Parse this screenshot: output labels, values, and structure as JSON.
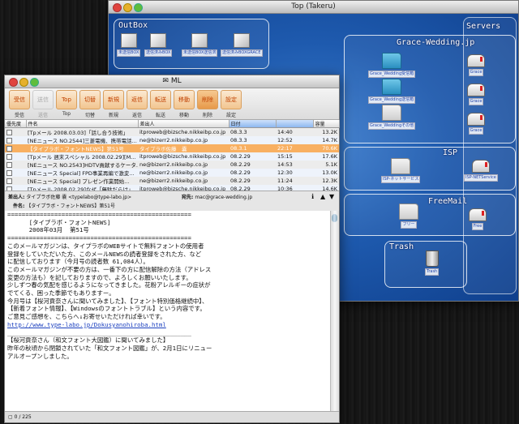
{
  "top_window": {
    "title": "Top (Takeru)",
    "outbox": {
      "label": "OutBox",
      "items": [
        "未送信BOX",
        "送信済みBOX",
        "未送信BOX送信済",
        "送信済みBOXGRACE"
      ]
    },
    "servers": {
      "label": "Servers"
    },
    "grace": {
      "label": "Grace-Wedding.jp",
      "folders": [
        "Grace_Wedding受信箱",
        "Grace_Wedding送信箱",
        "Grace_Weddingその他"
      ],
      "servers": [
        "Grace",
        "Grace",
        "Grace"
      ]
    },
    "isp": {
      "label": "ISP",
      "folder": "ISP-ネットサービス",
      "server": "ISP-NETService"
    },
    "freemail": {
      "label": "FreeMail",
      "folder": "フリー",
      "server": "Free"
    },
    "trash": {
      "label": "Trash",
      "icon_label": "Trash"
    }
  },
  "ml_window": {
    "title": "ML",
    "toolbar": [
      {
        "icon": "受信",
        "label": "受信",
        "disabled": false
      },
      {
        "icon": "送信",
        "label": "送信",
        "disabled": true
      },
      {
        "icon": "Top",
        "label": "Top",
        "disabled": false
      },
      {
        "icon": "切替",
        "label": "切替",
        "disabled": false
      },
      {
        "icon": "新規",
        "label": "新規",
        "disabled": false
      },
      {
        "icon": "返信",
        "label": "返信",
        "disabled": false
      },
      {
        "icon": "転送",
        "label": "転送",
        "disabled": false
      },
      {
        "icon": "移動",
        "label": "移動",
        "disabled": false
      },
      {
        "icon": "削除",
        "label": "削除",
        "disabled": false
      },
      {
        "icon": "設定",
        "label": "設定",
        "disabled": false
      }
    ],
    "columns": [
      "優先度",
      "件名",
      "差出人",
      "日付",
      "",
      "容量"
    ],
    "rows": [
      {
        "subject": "[Tpメール 2008.03.03]「話し合う技術」",
        "from": "itproweb@bizsche.nikkeibp.co.jp",
        "date": "08.3.3",
        "time": "14:40",
        "size": "13.2K"
      },
      {
        "subject": "[NEニュース NO.2544]三菱電機、携帯電話...",
        "from": "ne@bizerr2.nikkeibp.co.jp",
        "date": "08.3.3",
        "time": "12:52",
        "size": "14.7K"
      },
      {
        "subject": "【タイプラボ・フォントNEWS】第51号",
        "from": "タイプラボ佐藤　嚢",
        "date": "08.3.1",
        "time": "22:17",
        "size": "70.6K"
      },
      {
        "subject": "[Tpメール 週末スペシャル 2008.02.29][M...",
        "from": "itproweb@bizsche.nikkeibp.co.jp",
        "date": "08.2.29",
        "time": "15:15",
        "size": "17.6K"
      },
      {
        "subject": "[NEニュース NO.2543]HDTV貢献するケータ...",
        "from": "ne@bizerr2.nikkeibp.co.jp",
        "date": "08.2.29",
        "time": "14:53",
        "size": "5.1K"
      },
      {
        "subject": "[NEニュース Special] FPD事業再編で激変...",
        "from": "ne@bizerr2.nikkeibp.co.jp",
        "date": "08.2.29",
        "time": "12:30",
        "size": "13.0K"
      },
      {
        "subject": "[NEニュース Special] プレゼン作業開始...",
        "from": "ne@bizerr2.nikkeibp.co.jp",
        "date": "08.2.29",
        "time": "11:24",
        "size": "12.3K"
      },
      {
        "subject": "[Tpメール 2008.02.29]なぜ「無駄だらけ」...",
        "from": "itproweb@bizsche.nikkeibp.co.jp",
        "date": "08.2.29",
        "time": "10:36",
        "size": "14.6K"
      }
    ],
    "header": {
      "from_label": "差出人:",
      "from_value": "タイプラボ佐藤 嚢 <typelabo@type-labo.jp>",
      "subject_label": "件名:",
      "subject_value": "【タイプラボ・フォントNEWS】第51号",
      "to_label": "宛先:",
      "to_value": "mac@grace-wedding.jp"
    },
    "body_lines": [
      "",
      "===================================================",
      "      [タイプラボ・フォントNEWS]",
      "      2008年03月  第51号",
      "===================================================",
      "",
      "このメールマガジンは、タイプラボのWEBサイトで無料フォントの使用者",
      "登録をしていただいた方、このメールNEWSの読者登録をされた方、など",
      "に配信しております（今月号の読者数 61,084人）。",
      "",
      "このメールマガジンが不要の方は、一番下の方に配信解除の方法（アドレス",
      "変更の方法も）を記しておりますので、よろしくお願いいたします。",
      "",
      "少しずつ春の気配を感じるようになってきました。花粉アレルギーの症状が",
      "でてくる、困った季節でもありますー。",
      "今月号は【桜河貢奈さんに聞いてみました】、【フォント特別価格継続中】、",
      "【新着フォント情報】、【Windowsのフォントトラブル】という内容です。",
      "",
      "ご意見ご感想を、こちらへ↓お寄せいただければ幸いです。",
      "http://www.type-labo.jp/Dokusyanohiroba.html",
      "",
      "",
      "___________________________________________________",
      "【桜河貢奈さん（和文フォント大図鑑）に聞いてみました】",
      "",
      "昨年の秋頃から閉鎖されていた「和文フォント図鑑」が、2月1日にリニュー",
      "アルオープンしました。"
    ],
    "status": "0 / 225"
  }
}
